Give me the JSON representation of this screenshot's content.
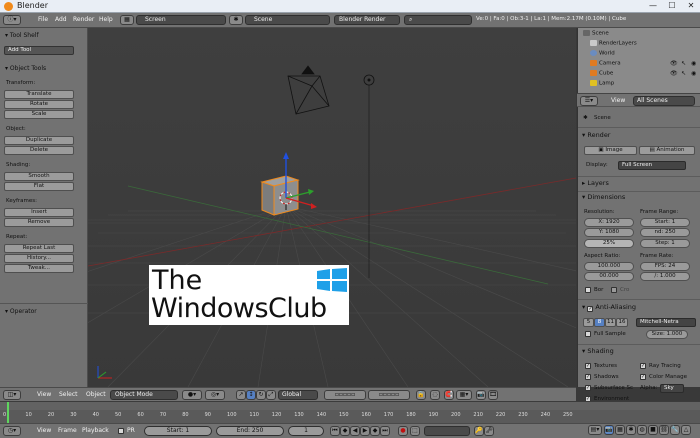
{
  "window": {
    "title": "Blender",
    "minimize": "—",
    "maximize": "☐",
    "close": "✕"
  },
  "info_header": {
    "menus": [
      "File",
      "Add",
      "Render",
      "Help"
    ],
    "screen_field": "Screen",
    "scene_field": "Scene",
    "render_engine": "Blender Render",
    "stats": "Ve:0 | Fa:0 | Ob:3-1 | La:1 | Mem:2.17M (0.10M) | Cube"
  },
  "tool_shelf": {
    "title": "Tool Shelf",
    "add_tool": "Add Tool",
    "object_tools": "Object Tools",
    "transform_label": "Transform:",
    "translate": "Translate",
    "rotate": "Rotate",
    "scale": "Scale",
    "object_label": "Object:",
    "duplicate": "Duplicate",
    "delete": "Delete",
    "shading_label": "Shading:",
    "smooth": "Smooth",
    "flat": "Flat",
    "keyframes_label": "Keyframes:",
    "insert": "Insert",
    "remove": "Remove",
    "repeat_label": "Repeat:",
    "repeat_last": "Repeat Last",
    "history": "History...",
    "tweak": "Tweak...",
    "operator": "Operator"
  },
  "outliner": {
    "items": [
      "Scene",
      "RenderLayers",
      "World",
      "Camera",
      "Cube",
      "Lamp"
    ]
  },
  "properties": {
    "view_menu": "View",
    "scope": "All Scenes",
    "breadcrumb": "Scene",
    "render": "Render",
    "image_btn": "Image",
    "animation_btn": "Animation",
    "display_label": "Display:",
    "display_value": "Full Screen",
    "layers": "Layers",
    "dimensions": "Dimensions",
    "resolution_label": "Resolution:",
    "res_x": "X: 1920",
    "res_y": "Y: 1080",
    "res_pct": "25%",
    "frame_range_label": "Frame Range:",
    "start": "Start: 1",
    "end": "nd: 250",
    "step": "Step: 1",
    "aspect_label": "Aspect Ratio:",
    "aspect_x": "100.000",
    "aspect_y": "00.000",
    "frame_rate_label": "Frame Rate:",
    "fps": "FPS: 24",
    "fps_base": "/: 1.000",
    "bor": "Bor",
    "cro": "Cro",
    "anti_aliasing": "Anti-Aliasing",
    "aa_levels": [
      "5",
      "8",
      "11",
      "16"
    ],
    "aa_filter": "Mitchell-Netra",
    "full_sample": "Full Sample",
    "size": "Size: 1.000",
    "shading": "Shading",
    "textures": "Textures",
    "ray_tracing": "Ray Tracing",
    "shadows": "Shadows",
    "color_manage": "Color Manage",
    "subsurface": "Subsurface Sc",
    "alpha_label": "Alpha:",
    "alpha_value": "Sky",
    "environment": "Environment"
  },
  "viewport_header": {
    "view": "View",
    "select": "Select",
    "object": "Object",
    "mode": "Object Mode",
    "orientation": "Global"
  },
  "timeline": {
    "ticks": [
      "0",
      "10",
      "20",
      "30",
      "40",
      "50",
      "60",
      "70",
      "80",
      "90",
      "100",
      "110",
      "120",
      "130",
      "140",
      "150",
      "160",
      "170",
      "180",
      "190",
      "200",
      "210",
      "220",
      "230",
      "240",
      "250"
    ],
    "view": "View",
    "frame": "Frame",
    "playback": "Playback",
    "pr": "PR",
    "start": "Start: 1",
    "end": "End: 250",
    "current": "1"
  },
  "watermark": {
    "line1": "The",
    "line2": "WindowsClub"
  },
  "colors": {
    "selection": "#f08a1c",
    "axis_x": "#d02020",
    "axis_y": "#2ca02c",
    "axis_z": "#2050e0"
  }
}
